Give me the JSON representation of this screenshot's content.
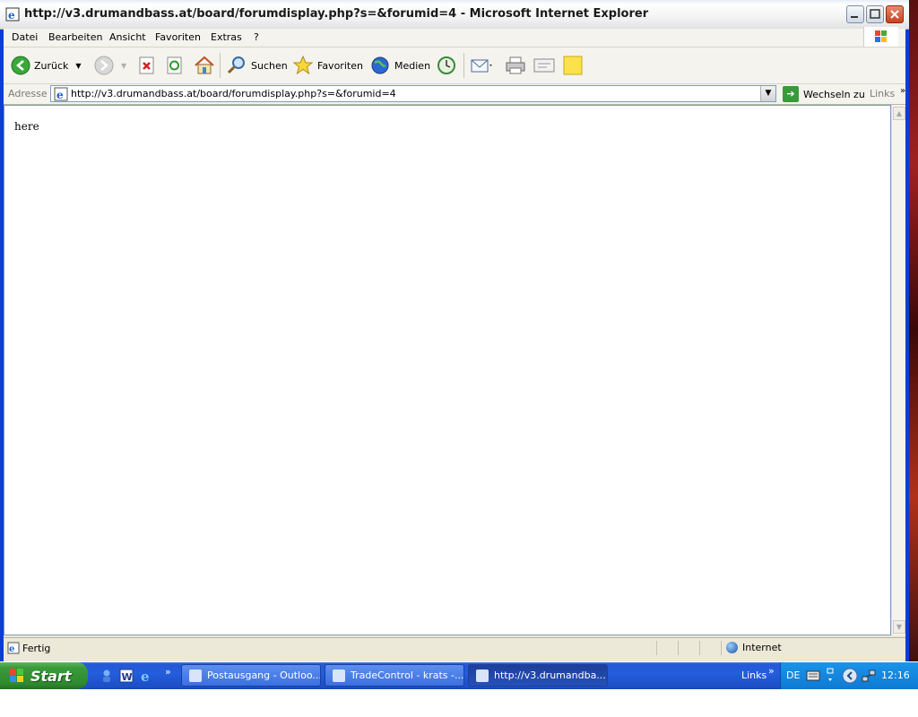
{
  "window": {
    "title": "http://v3.drumandbass.at/board/forumdisplay.php?s=&forumid=4 - Microsoft Internet Explorer"
  },
  "menu": [
    "Datei",
    "Bearbeiten",
    "Ansicht",
    "Favoriten",
    "Extras",
    "?"
  ],
  "toolbar": {
    "back_label": "Zurück",
    "search_label": "Suchen",
    "favorites_label": "Favoriten",
    "media_label": "Medien"
  },
  "address": {
    "label": "Adresse",
    "url": "http://v3.drumandbass.at/board/forumdisplay.php?s=&forumid=4",
    "go_label": "Wechseln zu",
    "links_label": "Links"
  },
  "content": {
    "text": "here"
  },
  "status": {
    "text": "Fertig",
    "zone": "Internet"
  },
  "taskbar": {
    "start_label": "Start",
    "tasks": [
      "Postausgang - Outloo...",
      "TradeControl - krats -...",
      "http://v3.drumandba..."
    ],
    "links_label": "Links",
    "language": "DE",
    "clock": "12:16"
  },
  "colors": {
    "taskbar": "#245edc",
    "start": "#3a9a3a",
    "window_border": "#0a3fd0"
  }
}
